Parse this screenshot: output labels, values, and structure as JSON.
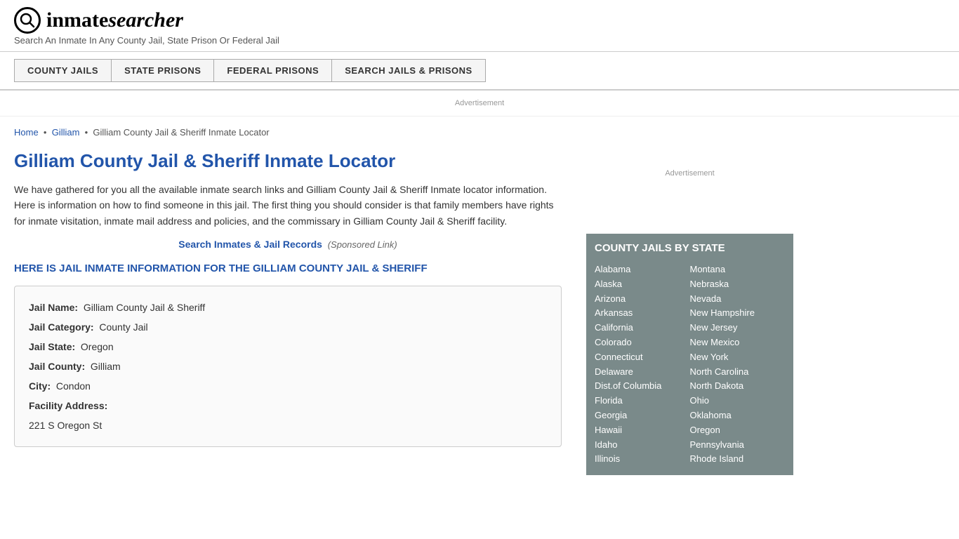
{
  "header": {
    "logo_icon": "🔍",
    "logo_text_plain": "inmate",
    "logo_text_italic": "searcher",
    "tagline": "Search An Inmate In Any County Jail, State Prison Or Federal Jail"
  },
  "nav": {
    "items": [
      {
        "label": "COUNTY JAILS",
        "id": "county-jails"
      },
      {
        "label": "STATE PRISONS",
        "id": "state-prisons"
      },
      {
        "label": "FEDERAL PRISONS",
        "id": "federal-prisons"
      },
      {
        "label": "SEARCH JAILS & PRISONS",
        "id": "search-jails"
      }
    ]
  },
  "ad": {
    "label": "Advertisement"
  },
  "breadcrumb": {
    "home": "Home",
    "parent": "Gilliam",
    "current": "Gilliam County Jail & Sheriff Inmate Locator"
  },
  "page": {
    "title": "Gilliam County Jail & Sheriff Inmate Locator",
    "description": "We have gathered for you all the available inmate search links and Gilliam County Jail & Sheriff Inmate locator information. Here is information on how to find someone in this jail. The first thing you should consider is that family members have rights for inmate visitation, inmate mail address and policies, and the commissary in Gilliam County Jail & Sheriff facility.",
    "sponsored_link_text": "Search Inmates & Jail Records",
    "sponsored_link_suffix": "(Sponsored Link)",
    "info_heading": "HERE IS JAIL INMATE INFORMATION FOR THE GILLIAM COUNTY JAIL & SHERIFF",
    "jail_name_label": "Jail Name:",
    "jail_name_value": "Gilliam County Jail & Sheriff",
    "jail_category_label": "Jail Category:",
    "jail_category_value": "County Jail",
    "jail_state_label": "Jail State:",
    "jail_state_value": "Oregon",
    "jail_county_label": "Jail County:",
    "jail_county_value": "Gilliam",
    "city_label": "City:",
    "city_value": "Condon",
    "facility_address_label": "Facility Address:",
    "facility_address_value": "221 S Oregon St"
  },
  "sidebar": {
    "ad_label": "Advertisement",
    "county_jails_title": "COUNTY JAILS BY STATE",
    "states_col1": [
      "Alabama",
      "Alaska",
      "Arizona",
      "Arkansas",
      "California",
      "Colorado",
      "Connecticut",
      "Delaware",
      "Dist.of Columbia",
      "Florida",
      "Georgia",
      "Hawaii",
      "Idaho",
      "Illinois"
    ],
    "states_col2": [
      "Montana",
      "Nebraska",
      "Nevada",
      "New Hampshire",
      "New Jersey",
      "New Mexico",
      "New York",
      "North Carolina",
      "North Dakota",
      "Ohio",
      "Oklahoma",
      "Oregon",
      "Pennsylvania",
      "Rhode Island"
    ]
  }
}
